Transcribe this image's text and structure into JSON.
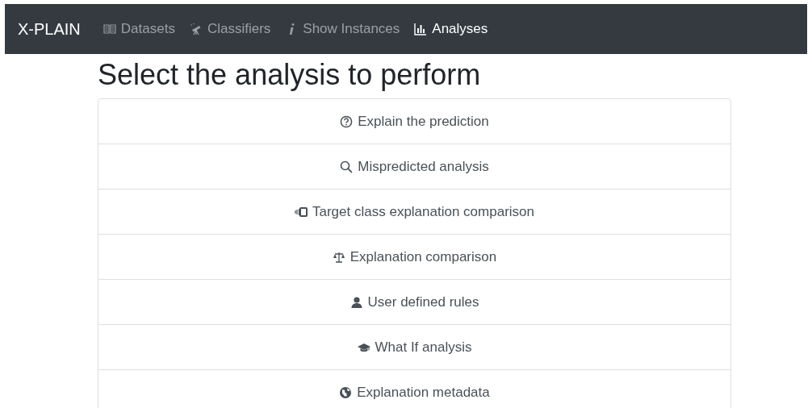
{
  "navbar": {
    "brand": "X-PLAIN",
    "items": [
      {
        "label": "Datasets",
        "selected": false
      },
      {
        "label": "Classifiers",
        "selected": false
      },
      {
        "label": "Show Instances",
        "selected": false
      },
      {
        "label": "Analyses",
        "selected": true
      }
    ]
  },
  "heading": "Select the analysis to perform",
  "analyses": [
    {
      "label": "Explain the prediction"
    },
    {
      "label": "Mispredicted analysis"
    },
    {
      "label": "Target class explanation comparison"
    },
    {
      "label": "Explanation comparison"
    },
    {
      "label": "User defined rules"
    },
    {
      "label": "What If analysis"
    },
    {
      "label": "Explanation metadata"
    }
  ]
}
